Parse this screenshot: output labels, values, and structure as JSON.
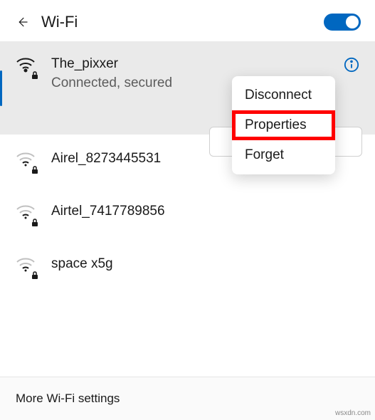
{
  "header": {
    "title": "Wi-Fi",
    "toggle_on": true
  },
  "networks": {
    "connected": {
      "name": "The_pixxer",
      "status": "Connected, secured",
      "secured": true,
      "signal_strength": 4
    },
    "available": [
      {
        "name": "Airel_8273445531",
        "secured": true,
        "signal_strength": 2
      },
      {
        "name": "Airtel_7417789856",
        "secured": true,
        "signal_strength": 2
      },
      {
        "name": "space x5g",
        "secured": true,
        "signal_strength": 2
      }
    ]
  },
  "context_menu": {
    "items": [
      {
        "label": "Disconnect"
      },
      {
        "label": "Properties",
        "highlighted": true
      },
      {
        "label": "Forget"
      }
    ]
  },
  "footer": {
    "more_settings": "More Wi-Fi settings"
  },
  "watermark": "wsxdn.com"
}
